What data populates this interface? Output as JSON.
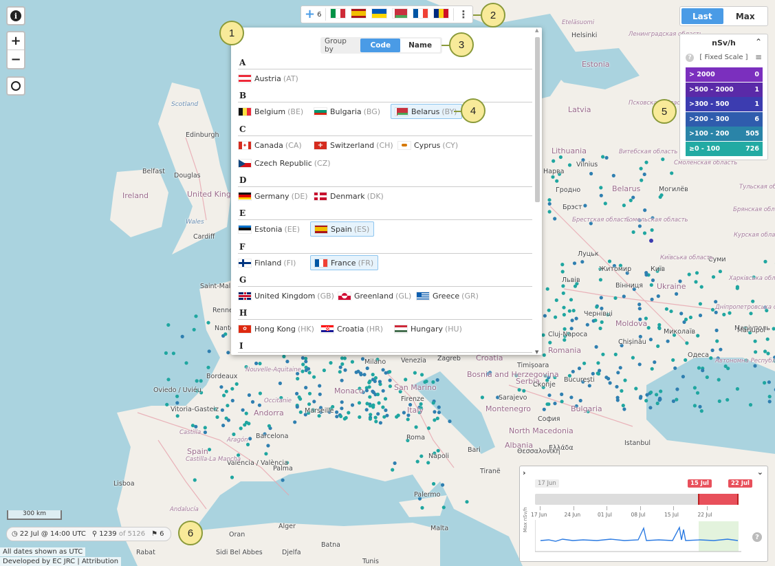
{
  "map_labels": {
    "countries": [
      "Ireland",
      "United Kingdom",
      "Spain",
      "Italy",
      "Romania",
      "Bulgaria",
      "Moldova",
      "Ukraine",
      "Belarus",
      "Lithuania",
      "Latvia",
      "Estonia",
      "Bosnia and Herzegovina",
      "Serbia",
      "Montenegro",
      "North Macedonia",
      "Albania",
      "Croatia",
      "San Marino",
      "Monaco",
      "Andorra",
      "Ελλάδα"
    ],
    "cities": [
      "Helsinki",
      "Edinburgh",
      "Belfast",
      "Douglas",
      "Cardiff",
      "Bordeaux",
      "Oviedo / Uviéu",
      "Vitoria-Gasteiz",
      "Barcelona",
      "Valencia / València",
      "Palma",
      "Lisboa",
      "Rabat",
      "Oran",
      "Alger",
      "Batna",
      "Djelfa",
      "Sidi Bel Abbes",
      "Marseille",
      "Milano",
      "Venezia",
      "Zagreb",
      "Firenze",
      "Roma",
      "Napoli",
      "Bari",
      "Palermo",
      "Malta",
      "Sarajevo",
      "Timișoara",
      "București",
      "Chișinău",
      "Cluj-Napoca",
      "Миколаїв",
      "Одеса",
      "Маріуполь",
      "Київ",
      "Житомир",
      "Вінниця",
      "Чернівці",
      "Луцьк",
      "Львів",
      "Суми",
      "Гродно",
      "Vilnius",
      "Могилёв",
      "Брэст",
      "Нарва",
      "Tunis",
      "Istanbul",
      "София",
      "Скопје",
      "Θεσσαλονίκη",
      "Mariupol",
      "Tiranë",
      "Rennes",
      "Nantes",
      "Saint-Malo"
    ],
    "seas": [
      "Scotland",
      "Wales",
      "Nouvelle-Aquitaine",
      "Occitanie",
      "Castilla",
      "Aragón",
      "Castilla-La Mancha",
      "Andalucía",
      "Автономна Республіка Крим",
      "Харківська область",
      "Днiпропетровська область",
      "Київська область",
      "Гомельская область",
      "Брестская область",
      "Витебская область",
      "Смоленская область",
      "Курская область",
      "Брянская область",
      "Тульская область",
      "Ленинградская область",
      "Псковская область",
      "Eteläsuomi"
    ]
  },
  "flagbar": {
    "add_count": "6",
    "flags": [
      "IT",
      "ES",
      "UA",
      "BY",
      "FR",
      "RO"
    ]
  },
  "panel": {
    "groupby_label": "Group by",
    "groupby_options": [
      "Code",
      "Name"
    ],
    "groupby_selected": "Code",
    "sections": [
      {
        "letter": "A",
        "items": [
          {
            "name": "Austria",
            "code": "(AT)",
            "flag": "AT"
          }
        ]
      },
      {
        "letter": "B",
        "items": [
          {
            "name": "Belgium",
            "code": "(BE)",
            "flag": "BE"
          },
          {
            "name": "Bulgaria",
            "code": "(BG)",
            "flag": "BG"
          },
          {
            "name": "Belarus",
            "code": "(BY)",
            "flag": "BY",
            "selected": true
          }
        ]
      },
      {
        "letter": "C",
        "items": [
          {
            "name": "Canada",
            "code": "(CA)",
            "flag": "CA"
          },
          {
            "name": "Switzerland",
            "code": "(CH)",
            "flag": "CH"
          },
          {
            "name": "Cyprus",
            "code": "(CY)",
            "flag": "CY"
          },
          {
            "name": "Czech Republic",
            "code": "(CZ)",
            "flag": "CZ"
          }
        ]
      },
      {
        "letter": "D",
        "items": [
          {
            "name": "Germany",
            "code": "(DE)",
            "flag": "DE"
          },
          {
            "name": "Denmark",
            "code": "(DK)",
            "flag": "DK"
          }
        ]
      },
      {
        "letter": "E",
        "items": [
          {
            "name": "Estonia",
            "code": "(EE)",
            "flag": "EE"
          },
          {
            "name": "Spain",
            "code": "(ES)",
            "flag": "ES",
            "selected": true
          }
        ]
      },
      {
        "letter": "F",
        "items": [
          {
            "name": "Finland",
            "code": "(FI)",
            "flag": "FI"
          },
          {
            "name": "France",
            "code": "(FR)",
            "flag": "FR",
            "selected": true
          }
        ]
      },
      {
        "letter": "G",
        "items": [
          {
            "name": "United Kingdom",
            "code": "(GB)",
            "flag": "GB"
          },
          {
            "name": "Greenland",
            "code": "(GL)",
            "flag": "GL"
          },
          {
            "name": "Greece",
            "code": "(GR)",
            "flag": "GR"
          }
        ]
      },
      {
        "letter": "H",
        "items": [
          {
            "name": "Hong Kong",
            "code": "(HK)",
            "flag": "HK"
          },
          {
            "name": "Croatia",
            "code": "(HR)",
            "flag": "HR"
          },
          {
            "name": "Hungary",
            "code": "(HU)",
            "flag": "HU"
          }
        ]
      },
      {
        "letter": "I",
        "items": []
      }
    ]
  },
  "badges": [
    "1",
    "2",
    "3",
    "4",
    "5",
    "6"
  ],
  "toggle": {
    "options": [
      "Last",
      "Max"
    ],
    "selected": "Last"
  },
  "legend": {
    "title": "nSv/h",
    "scale_label": "[ Fixed Scale ]",
    "rows": [
      {
        "label": "> 2000",
        "count": "0",
        "color": "#7b2fbe"
      },
      {
        "label": ">500 - 2000",
        "count": "1",
        "color": "#5a2aa8"
      },
      {
        "label": ">300 - 500",
        "count": "1",
        "color": "#3c3cb0"
      },
      {
        "label": ">200 - 300",
        "count": "6",
        "color": "#2f5cad"
      },
      {
        "label": ">100 - 200",
        "count": "505",
        "color": "#2a84a8"
      },
      {
        "label": "≥0 - 100",
        "count": "726",
        "color": "#22aaa3"
      }
    ]
  },
  "timeline": {
    "start_label": "17 Jun",
    "range_start": "15 Jul",
    "range_end": "22 Jul",
    "ticks": [
      "17 Jun",
      "24 Jun",
      "01 Jul",
      "08 Jul",
      "15 Jul",
      "22 Jul"
    ],
    "ylabel": "Max nSv/h"
  },
  "status": {
    "datetime": "22 Jul @ 14:00 UTC",
    "stations_shown": "1239",
    "stations_total": "of 5126",
    "flags_count": "6"
  },
  "scale": "300 km",
  "attribution": {
    "note": "All dates shown as UTC",
    "credit": "Developed by EC JRC | Attribution"
  },
  "colors": {
    "accent": "#4a9be6",
    "station": "#2a93a6",
    "selected_bg": "#e6f3fc",
    "range": "#e8505b"
  }
}
